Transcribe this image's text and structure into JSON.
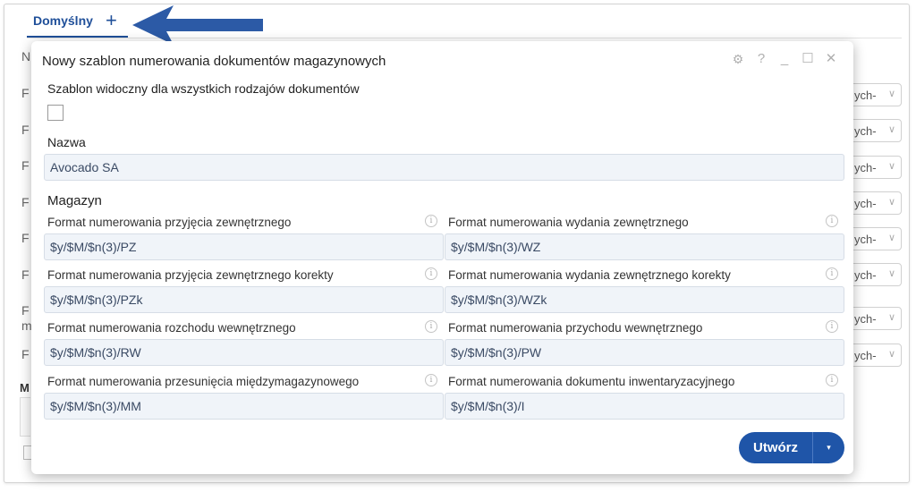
{
  "tabs": {
    "default_label": "Domyślny",
    "add_label": "+"
  },
  "background": {
    "labels": [
      "N",
      "F",
      "F",
      "F",
      "F",
      "F",
      "F",
      "F",
      "m",
      "F"
    ],
    "selects": [
      "ych-",
      "ych-",
      "ych-",
      "ych-",
      "ych-",
      "ych-",
      "ych-",
      "ych-"
    ],
    "bold_label": "M"
  },
  "dialog": {
    "title": "Nowy szablon numerowania dokumentów magazynowych",
    "controls": {
      "settings": "⚙",
      "help": "?",
      "minimize": "_",
      "maximize": "☐",
      "close": "✕"
    },
    "visibility_label": "Szablon widoczny dla wszystkich rodzajów dokumentów",
    "visibility_checked": false,
    "name_label": "Nazwa",
    "name_value": "Avocado SA",
    "section_title": "Magazyn",
    "fields": [
      {
        "label": "Format numerowania przyjęcia zewnętrznego",
        "value": "$y/$M/$n(3)/PZ"
      },
      {
        "label": "Format numerowania wydania zewnętrznego",
        "value": "$y/$M/$n(3)/WZ"
      },
      {
        "label": "Format numerowania przyjęcia zewnętrznego korekty",
        "value": "$y/$M/$n(3)/PZk"
      },
      {
        "label": "Format numerowania wydania zewnętrznego korekty",
        "value": "$y/$M/$n(3)/WZk"
      },
      {
        "label": "Format numerowania rozchodu wewnętrznego",
        "value": "$y/$M/$n(3)/RW"
      },
      {
        "label": "Format numerowania przychodu wewnętrznego",
        "value": "$y/$M/$n(3)/PW"
      },
      {
        "label": "Format numerowania przesunięcia międzymagazynowego",
        "value": "$y/$M/$n(3)/MM"
      },
      {
        "label": "Format numerowania dokumentu inwentaryzacyjnego",
        "value": "$y/$M/$n(3)/I"
      }
    ],
    "create_button": "Utwórz",
    "create_dropdown": "▾",
    "info_glyph": "i"
  },
  "colors": {
    "accent": "#1f55a8",
    "tab_accent": "#1f4f99",
    "field_bg": "#f0f4f9"
  }
}
